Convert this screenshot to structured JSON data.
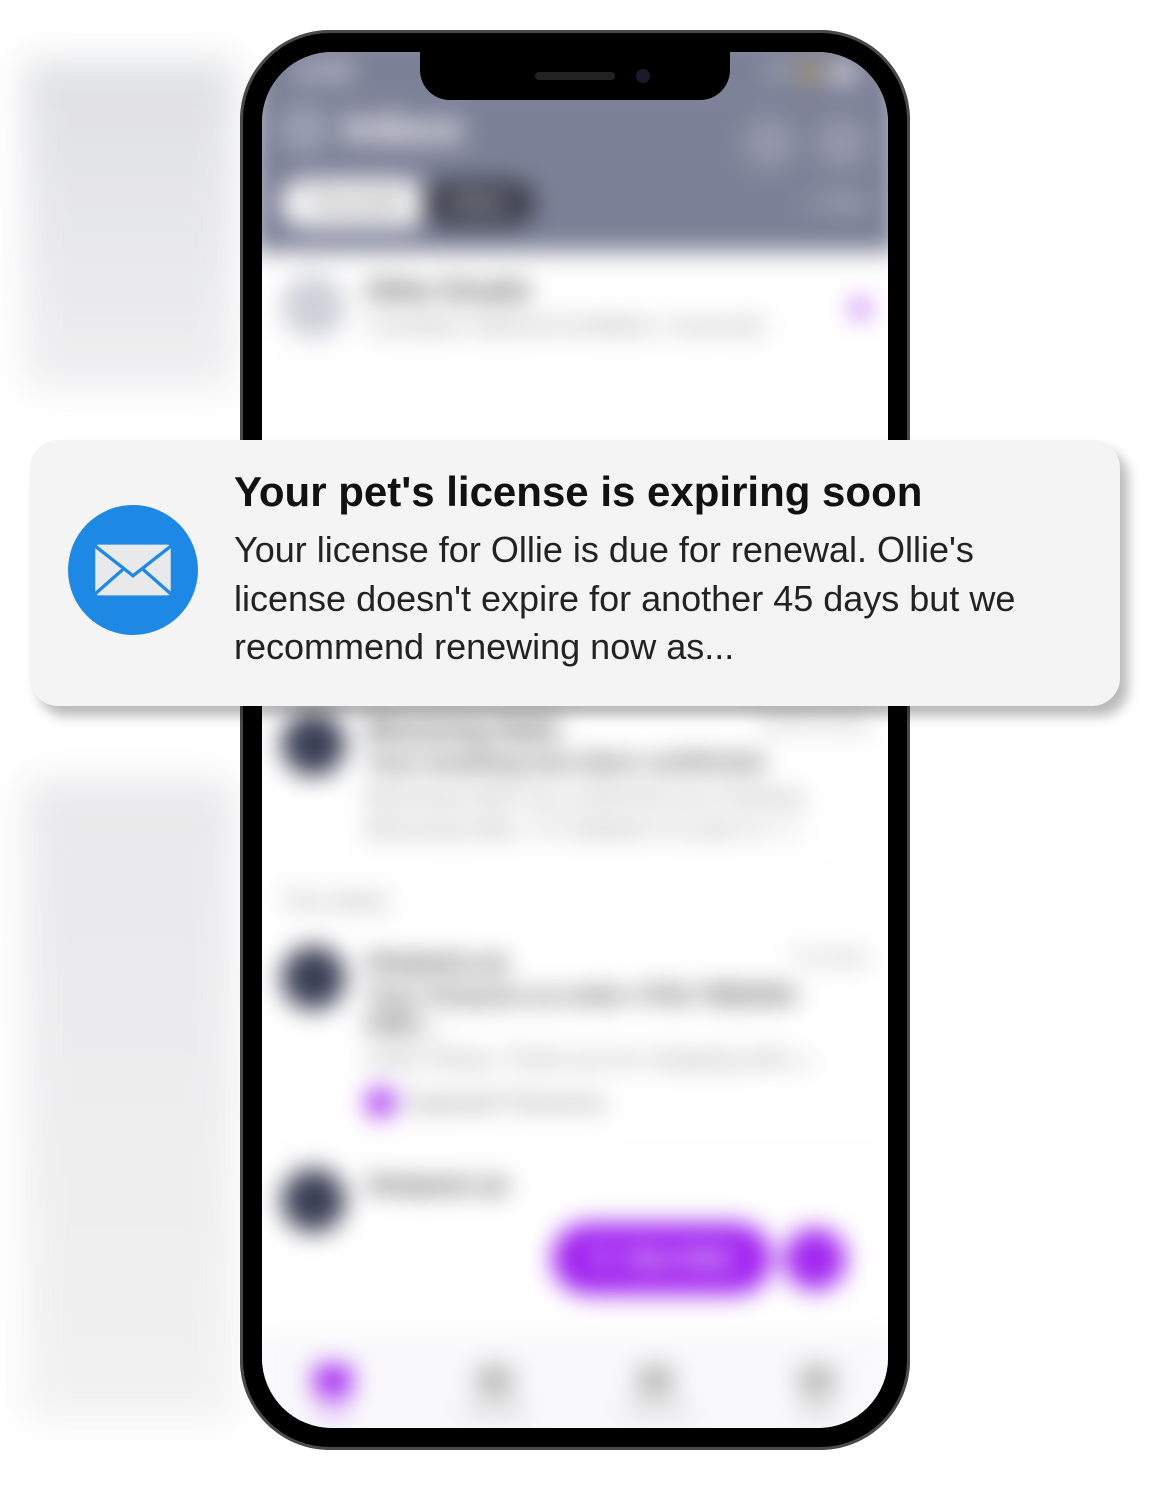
{
  "status": {
    "time": "12:06"
  },
  "header": {
    "title": "Inbox",
    "tabs": {
      "active": "Focused",
      "inactive": "Other"
    },
    "filter": "Filter"
  },
  "sections": {
    "other": {
      "sender": "Other Emails",
      "preview": "Canadian National Exhibition, Gusmodi..."
    },
    "yesterday_label": "Yesterday",
    "yesterday": {
      "sender": "Blooming Nails",
      "date": "Wednesday",
      "subject": "Your booking has been confirmed",
      "preview": "Blooming Nails has confirmed your booking. Blooming Nails, 171 Baldwin St suite #1, T..."
    },
    "thisweek_label": "This Week",
    "thisweek": {
      "sender": "Amazon.ca",
      "date": "Tuesday",
      "subject": "Your Amazon.ca order #702-7982555-0481...",
      "preview": "Hello Kelsey, Thank you for shopping with u...",
      "tag": "Expected Tomorrow"
    },
    "thisweek2": {
      "sender": "Amazon.ca"
    }
  },
  "fab": {
    "label": "New Mail"
  },
  "tabbar": {
    "items": [
      "Mail",
      "Calendar",
      "Channels",
      "Apps"
    ]
  },
  "notification": {
    "title": "Your pet's license is expiring soon",
    "body": "Your license for Ollie is due for renewal. Ollie's license doesn't expire for another 45 days but we recommend renewing now as..."
  }
}
